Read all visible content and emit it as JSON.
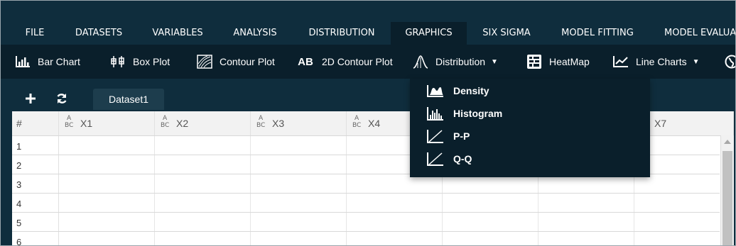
{
  "menu": {
    "items": [
      {
        "label": "FILE"
      },
      {
        "label": "DATASETS"
      },
      {
        "label": "VARIABLES"
      },
      {
        "label": "ANALYSIS"
      },
      {
        "label": "DISTRIBUTION"
      },
      {
        "label": "GRAPHICS"
      },
      {
        "label": "SIX SIGMA"
      },
      {
        "label": "MODEL FITTING"
      },
      {
        "label": "MODEL EVALUA"
      }
    ],
    "active": "GRAPHICS"
  },
  "toolbar": {
    "bar_chart": "Bar Chart",
    "box_plot": "Box Plot",
    "contour_plot": "Contour Plot",
    "contour2d_icon_text": "AB",
    "contour2d": "2D Contour Plot",
    "distribution": "Distribution",
    "heatmap": "HeatMap",
    "line_charts": "Line Charts"
  },
  "tabs": {
    "dataset_tab": "Dataset1"
  },
  "grid": {
    "row_header": "#",
    "columns": [
      "X1",
      "X2",
      "X3",
      "X4",
      "X7"
    ],
    "rows": [
      "1",
      "2",
      "3",
      "4",
      "5",
      "6"
    ]
  },
  "distribution_menu": {
    "items": [
      {
        "label": "Density",
        "icon": "density-icon"
      },
      {
        "label": "Histogram",
        "icon": "histogram-icon"
      },
      {
        "label": "P-P",
        "icon": "pp-plot-icon"
      },
      {
        "label": "Q-Q",
        "icon": "qq-plot-icon"
      }
    ]
  },
  "colors": {
    "background": "#0f2d3d",
    "toolbar": "#0a1f2b",
    "active_menu": "#0a1f2b"
  }
}
